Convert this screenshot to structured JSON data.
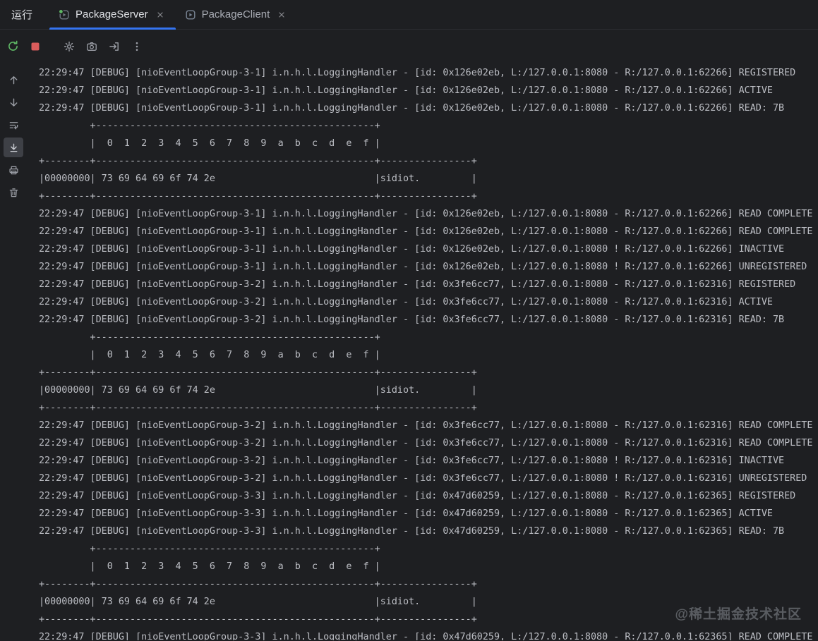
{
  "tool_window": {
    "title": "运行",
    "tabs": [
      {
        "label": "PackageServer",
        "state": "running"
      },
      {
        "label": "PackageClient",
        "state": "idle"
      }
    ]
  },
  "toolbar": {
    "icons": [
      "rerun-icon",
      "stop-icon",
      "settings-gear-icon",
      "camera-icon",
      "export-icon",
      "kebab-menu-icon"
    ]
  },
  "gutter": {
    "icons": [
      "arrow-up-icon",
      "arrow-down-icon",
      "soft-wrap-icon",
      "scroll-to-end-icon",
      "print-icon",
      "clear-all-icon"
    ],
    "selected": "scroll-to-end-icon"
  },
  "console": {
    "lines": [
      "22:29:47 [DEBUG] [nioEventLoopGroup-3-1] i.n.h.l.LoggingHandler - [id: 0x126e02eb, L:/127.0.0.1:8080 - R:/127.0.0.1:62266] REGISTERED",
      "22:29:47 [DEBUG] [nioEventLoopGroup-3-1] i.n.h.l.LoggingHandler - [id: 0x126e02eb, L:/127.0.0.1:8080 - R:/127.0.0.1:62266] ACTIVE",
      "22:29:47 [DEBUG] [nioEventLoopGroup-3-1] i.n.h.l.LoggingHandler - [id: 0x126e02eb, L:/127.0.0.1:8080 - R:/127.0.0.1:62266] READ: 7B",
      "         +-------------------------------------------------+",
      "         |  0  1  2  3  4  5  6  7  8  9  a  b  c  d  e  f |",
      "+--------+-------------------------------------------------+----------------+",
      "|00000000| 73 69 64 69 6f 74 2e                            |sidiot.         |",
      "+--------+-------------------------------------------------+----------------+",
      "22:29:47 [DEBUG] [nioEventLoopGroup-3-1] i.n.h.l.LoggingHandler - [id: 0x126e02eb, L:/127.0.0.1:8080 - R:/127.0.0.1:62266] READ COMPLETE",
      "22:29:47 [DEBUG] [nioEventLoopGroup-3-1] i.n.h.l.LoggingHandler - [id: 0x126e02eb, L:/127.0.0.1:8080 - R:/127.0.0.1:62266] READ COMPLETE",
      "22:29:47 [DEBUG] [nioEventLoopGroup-3-1] i.n.h.l.LoggingHandler - [id: 0x126e02eb, L:/127.0.0.1:8080 ! R:/127.0.0.1:62266] INACTIVE",
      "22:29:47 [DEBUG] [nioEventLoopGroup-3-1] i.n.h.l.LoggingHandler - [id: 0x126e02eb, L:/127.0.0.1:8080 ! R:/127.0.0.1:62266] UNREGISTERED",
      "22:29:47 [DEBUG] [nioEventLoopGroup-3-2] i.n.h.l.LoggingHandler - [id: 0x3fe6cc77, L:/127.0.0.1:8080 - R:/127.0.0.1:62316] REGISTERED",
      "22:29:47 [DEBUG] [nioEventLoopGroup-3-2] i.n.h.l.LoggingHandler - [id: 0x3fe6cc77, L:/127.0.0.1:8080 - R:/127.0.0.1:62316] ACTIVE",
      "22:29:47 [DEBUG] [nioEventLoopGroup-3-2] i.n.h.l.LoggingHandler - [id: 0x3fe6cc77, L:/127.0.0.1:8080 - R:/127.0.0.1:62316] READ: 7B",
      "         +-------------------------------------------------+",
      "         |  0  1  2  3  4  5  6  7  8  9  a  b  c  d  e  f |",
      "+--------+-------------------------------------------------+----------------+",
      "|00000000| 73 69 64 69 6f 74 2e                            |sidiot.         |",
      "+--------+-------------------------------------------------+----------------+",
      "22:29:47 [DEBUG] [nioEventLoopGroup-3-2] i.n.h.l.LoggingHandler - [id: 0x3fe6cc77, L:/127.0.0.1:8080 - R:/127.0.0.1:62316] READ COMPLETE",
      "22:29:47 [DEBUG] [nioEventLoopGroup-3-2] i.n.h.l.LoggingHandler - [id: 0x3fe6cc77, L:/127.0.0.1:8080 - R:/127.0.0.1:62316] READ COMPLETE",
      "22:29:47 [DEBUG] [nioEventLoopGroup-3-2] i.n.h.l.LoggingHandler - [id: 0x3fe6cc77, L:/127.0.0.1:8080 ! R:/127.0.0.1:62316] INACTIVE",
      "22:29:47 [DEBUG] [nioEventLoopGroup-3-2] i.n.h.l.LoggingHandler - [id: 0x3fe6cc77, L:/127.0.0.1:8080 ! R:/127.0.0.1:62316] UNREGISTERED",
      "22:29:47 [DEBUG] [nioEventLoopGroup-3-3] i.n.h.l.LoggingHandler - [id: 0x47d60259, L:/127.0.0.1:8080 - R:/127.0.0.1:62365] REGISTERED",
      "22:29:47 [DEBUG] [nioEventLoopGroup-3-3] i.n.h.l.LoggingHandler - [id: 0x47d60259, L:/127.0.0.1:8080 - R:/127.0.0.1:62365] ACTIVE",
      "22:29:47 [DEBUG] [nioEventLoopGroup-3-3] i.n.h.l.LoggingHandler - [id: 0x47d60259, L:/127.0.0.1:8080 - R:/127.0.0.1:62365] READ: 7B",
      "         +-------------------------------------------------+",
      "         |  0  1  2  3  4  5  6  7  8  9  a  b  c  d  e  f |",
      "+--------+-------------------------------------------------+----------------+",
      "|00000000| 73 69 64 69 6f 74 2e                            |sidiot.         |",
      "+--------+-------------------------------------------------+----------------+",
      "22:29:47 [DEBUG] [nioEventLoopGroup-3-3] i.n.h.l.LoggingHandler - [id: 0x47d60259, L:/127.0.0.1:8080 - R:/127.0.0.1:62365] READ COMPLETE"
    ]
  },
  "watermark": {
    "text": "@稀土掘金技术社区"
  },
  "colors": {
    "background": "#1E1F22",
    "console_text": "#BCBEC4",
    "active_tab_underline": "#3574F0",
    "rerun_green": "#5FB865",
    "stop_red": "#DB5C5C",
    "icon_gray": "#9DA0A8",
    "selected_button_background": "#3E4046",
    "watermark_gray": "#7C818A"
  }
}
